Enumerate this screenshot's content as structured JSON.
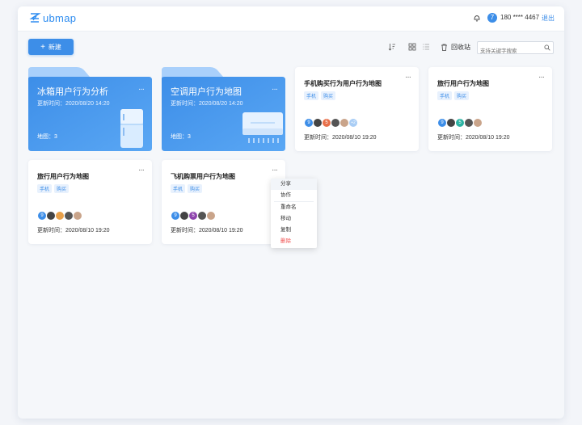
{
  "header": {
    "logo_text": "ubmap",
    "user_badge": "7",
    "phone": "180 **** 4467",
    "logout": "退出"
  },
  "toolbar": {
    "new_label": "新建",
    "recycle_label": "回收站",
    "search_placeholder": "支持关键字搜索"
  },
  "folders": [
    {
      "title": "冰箱用户行为分析",
      "updated": "更新时间：2020/08/20 14:20",
      "count": "地图：3",
      "icon": "fridge-illustration"
    },
    {
      "title": "空调用户行为地图",
      "updated": "更新时间：2020/08/20 14:20",
      "count": "地图：3",
      "icon": "air-conditioner-illustration"
    }
  ],
  "cards": [
    {
      "title": "手机购买行为用户行为地图",
      "tags": [
        "手机",
        "购买"
      ],
      "updated": "更新时间：2020/08/10  19:20",
      "avatar_letters": [
        "9",
        "",
        "5",
        "",
        "",
        "+2"
      ]
    },
    {
      "title": "旅行用户行为地图",
      "tags": [],
      "updated": "更新时间：2020/08/10  19:20",
      "avatar_letters": [
        "9",
        "",
        "5",
        "",
        ""
      ]
    },
    {
      "title": "旅行用户行为地图",
      "tags": [
        "手机",
        "购买"
      ],
      "updated": "更新时间：2020/08/10  19:20",
      "avatar_letters": [
        "9",
        "",
        "",
        "",
        ""
      ]
    },
    {
      "title": "飞机购票用户行为地图",
      "tags": [
        "手机",
        "购买"
      ],
      "updated": "更新时间：2020/08/10  19:20",
      "avatar_letters": [
        "9",
        "",
        "5",
        "",
        ""
      ]
    }
  ],
  "card2_tags": [
    "手机",
    "购买"
  ],
  "context_menu": [
    "分享",
    "协作",
    "重命名",
    "移动",
    "复制",
    "删除"
  ],
  "colors": {
    "accent": "#3d8ee8",
    "danger": "#f05050"
  }
}
